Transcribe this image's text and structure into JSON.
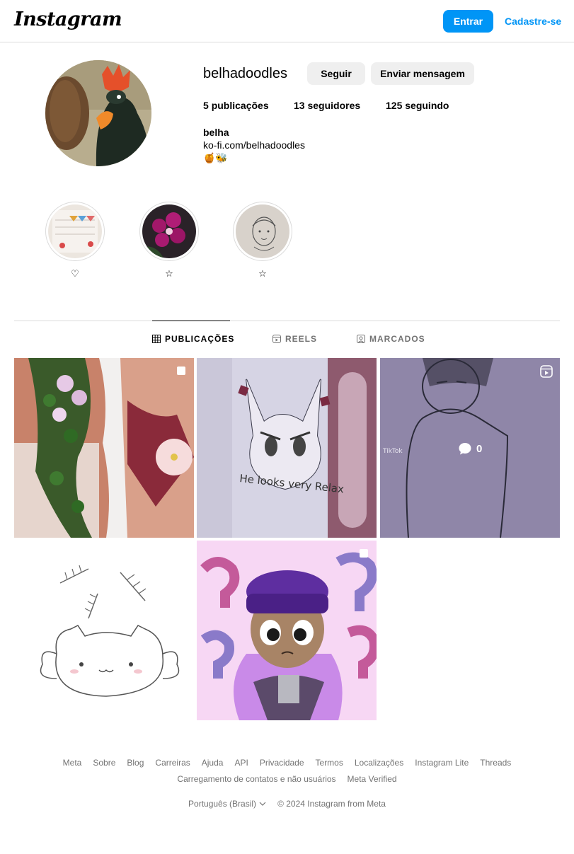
{
  "header": {
    "logo": "Instagram",
    "login_label": "Entrar",
    "signup_label": "Cadastre-se"
  },
  "profile": {
    "username": "belhadoodles",
    "follow_label": "Seguir",
    "message_label": "Enviar mensagem",
    "posts_count": "5",
    "posts_label": "publicações",
    "followers_count": "13",
    "followers_label": "seguidores",
    "following_count": "125",
    "following_label": "seguindo",
    "name": "belha",
    "link": "ko-fi.com/belhadoodles",
    "bio_emoji": "🍯🐝"
  },
  "highlights": [
    {
      "label": "♡"
    },
    {
      "label": "☆"
    },
    {
      "label": "☆"
    }
  ],
  "tabs": [
    {
      "label": "PUBLICAÇÕES",
      "icon": "grid-icon",
      "active": true
    },
    {
      "label": "REELS",
      "icon": "reels-icon",
      "active": false
    },
    {
      "label": "MARCADOS",
      "icon": "tagged-icon",
      "active": false
    }
  ],
  "posts": [
    {
      "description": "flowers",
      "badge": "carousel-icon"
    },
    {
      "description": "cat drawing",
      "badge": ""
    },
    {
      "description": "boy drawing reel",
      "badge": "reels-icon",
      "comments": "0"
    },
    {
      "description": "cat with fish bones",
      "badge": ""
    },
    {
      "description": "character with purple hair",
      "badge": "carousel-icon"
    }
  ],
  "footer": {
    "links_row1": [
      "Meta",
      "Sobre",
      "Blog",
      "Carreiras",
      "Ajuda",
      "API",
      "Privacidade",
      "Termos",
      "Localizações",
      "Instagram Lite",
      "Threads"
    ],
    "links_row2": [
      "Carregamento de contatos e não usuários",
      "Meta Verified"
    ],
    "language": "Português (Brasil)",
    "copyright": "© 2024 Instagram from Meta"
  },
  "colors": {
    "accent": "#0095f6",
    "button_gray": "#efefef",
    "border": "#dbdbdb",
    "muted_text": "#737373"
  }
}
